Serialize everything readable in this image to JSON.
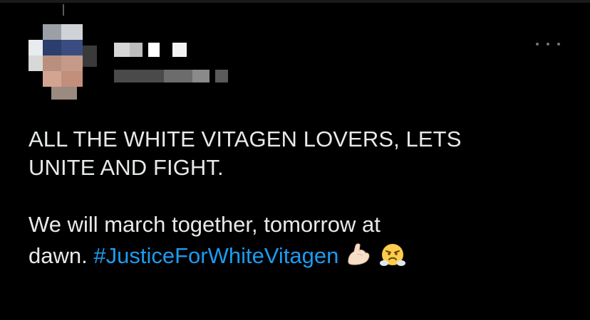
{
  "tweet": {
    "line1": "ALL THE WHITE VITAGEN LOVERS, LETS",
    "line2": "UNITE AND FIGHT.",
    "line3": "We will march together, tomorrow at",
    "line4_prefix": "dawn. ",
    "hashtag": "#JusticeForWhiteVitagen",
    "emojis": [
      "flexed-biceps",
      "steam-from-nose-face"
    ]
  },
  "colors": {
    "background": "#000000",
    "text": "#e7e9ea",
    "link": "#1d9bf0",
    "muted": "#71767b"
  },
  "icons": [
    "more-options-icon"
  ]
}
